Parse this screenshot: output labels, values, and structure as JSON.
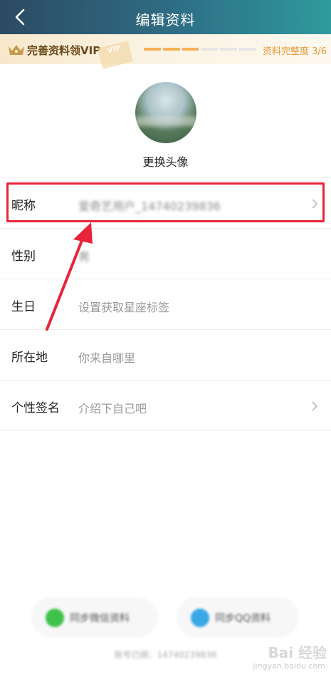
{
  "header": {
    "title": "编辑资料",
    "back_icon": "chevron-left-icon"
  },
  "vip_banner": {
    "text": "完善资料领VIP",
    "tag": "VIP",
    "progress_steps_total": 6,
    "progress_steps_done": 3,
    "completeness_text": "资料完整度 3/6",
    "accent": "#f4b056"
  },
  "avatar": {
    "change_label": "更换头像"
  },
  "rows": [
    {
      "label": "昵称",
      "value": "爱奇艺用户_14740239836",
      "has_chevron": true
    },
    {
      "label": "性别",
      "value": "男",
      "has_chevron": false
    },
    {
      "label": "生日",
      "value": "设置获取星座标签",
      "has_chevron": false
    },
    {
      "label": "所在地",
      "value": "你来自哪里",
      "has_chevron": false
    },
    {
      "label": "个性签名",
      "value": "介绍下自己吧",
      "has_chevron": true
    }
  ],
  "sync": {
    "wechat_label": "同步微信资料",
    "qq_label": "同步QQ资料",
    "wechat_color": "#3fc24a",
    "qq_color": "#3aa7e6"
  },
  "phone_bound": "账号已绑：14740239836",
  "watermark": {
    "main": "Bai 经验",
    "sub": "jingyan.baidu.com"
  },
  "highlight_color": "#e8243a"
}
